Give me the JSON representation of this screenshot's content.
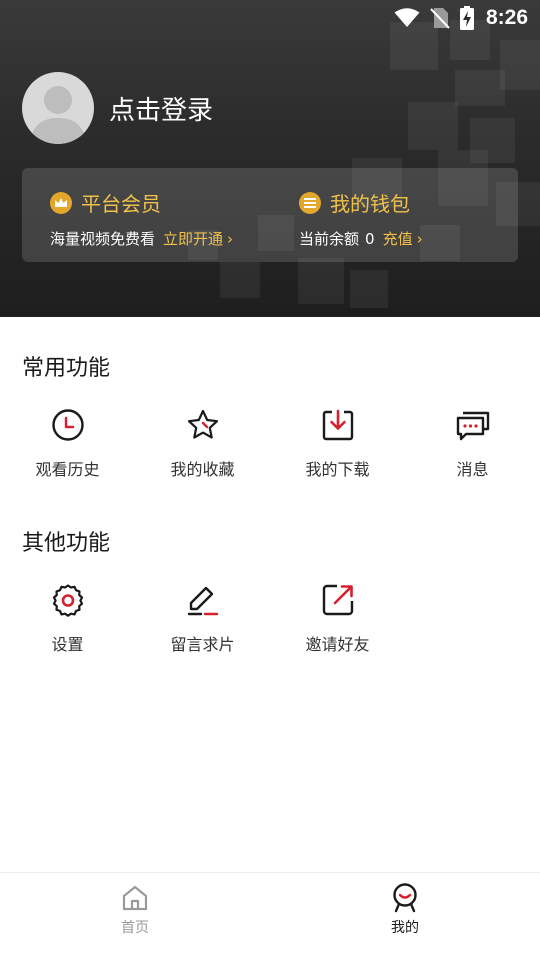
{
  "status_bar": {
    "time": "8:26",
    "icons": [
      "wifi-icon",
      "no-sim-icon",
      "battery-charging-icon"
    ]
  },
  "profile": {
    "login_text": "点击登录",
    "avatar": "default-avatar"
  },
  "membership_card": {
    "vip": {
      "icon": "crown-icon",
      "title": "平台会员",
      "subtitle": "海量视频免费看",
      "action": "立即开通"
    },
    "wallet": {
      "icon": "wallet-icon",
      "title": "我的钱包",
      "balance_label": "当前余额",
      "balance_value": "0",
      "action": "充值"
    }
  },
  "common_functions": {
    "title": "常用功能",
    "items": [
      {
        "label": "观看历史",
        "icon": "clock-icon"
      },
      {
        "label": "我的收藏",
        "icon": "star-icon"
      },
      {
        "label": "我的下载",
        "icon": "download-icon"
      },
      {
        "label": "消息",
        "icon": "message-icon"
      }
    ]
  },
  "other_functions": {
    "title": "其他功能",
    "items": [
      {
        "label": "设置",
        "icon": "gear-icon"
      },
      {
        "label": "留言求片",
        "icon": "edit-icon"
      },
      {
        "label": "邀请好友",
        "icon": "share-icon"
      }
    ]
  },
  "bottom_nav": {
    "items": [
      {
        "label": "首页",
        "icon": "home-icon",
        "active": false
      },
      {
        "label": "我的",
        "icon": "profile-icon",
        "active": true
      }
    ]
  },
  "colors": {
    "accent_gold": "#f0c14b",
    "accent_red": "#d6202d",
    "header_bg": "#2c2c2c"
  }
}
